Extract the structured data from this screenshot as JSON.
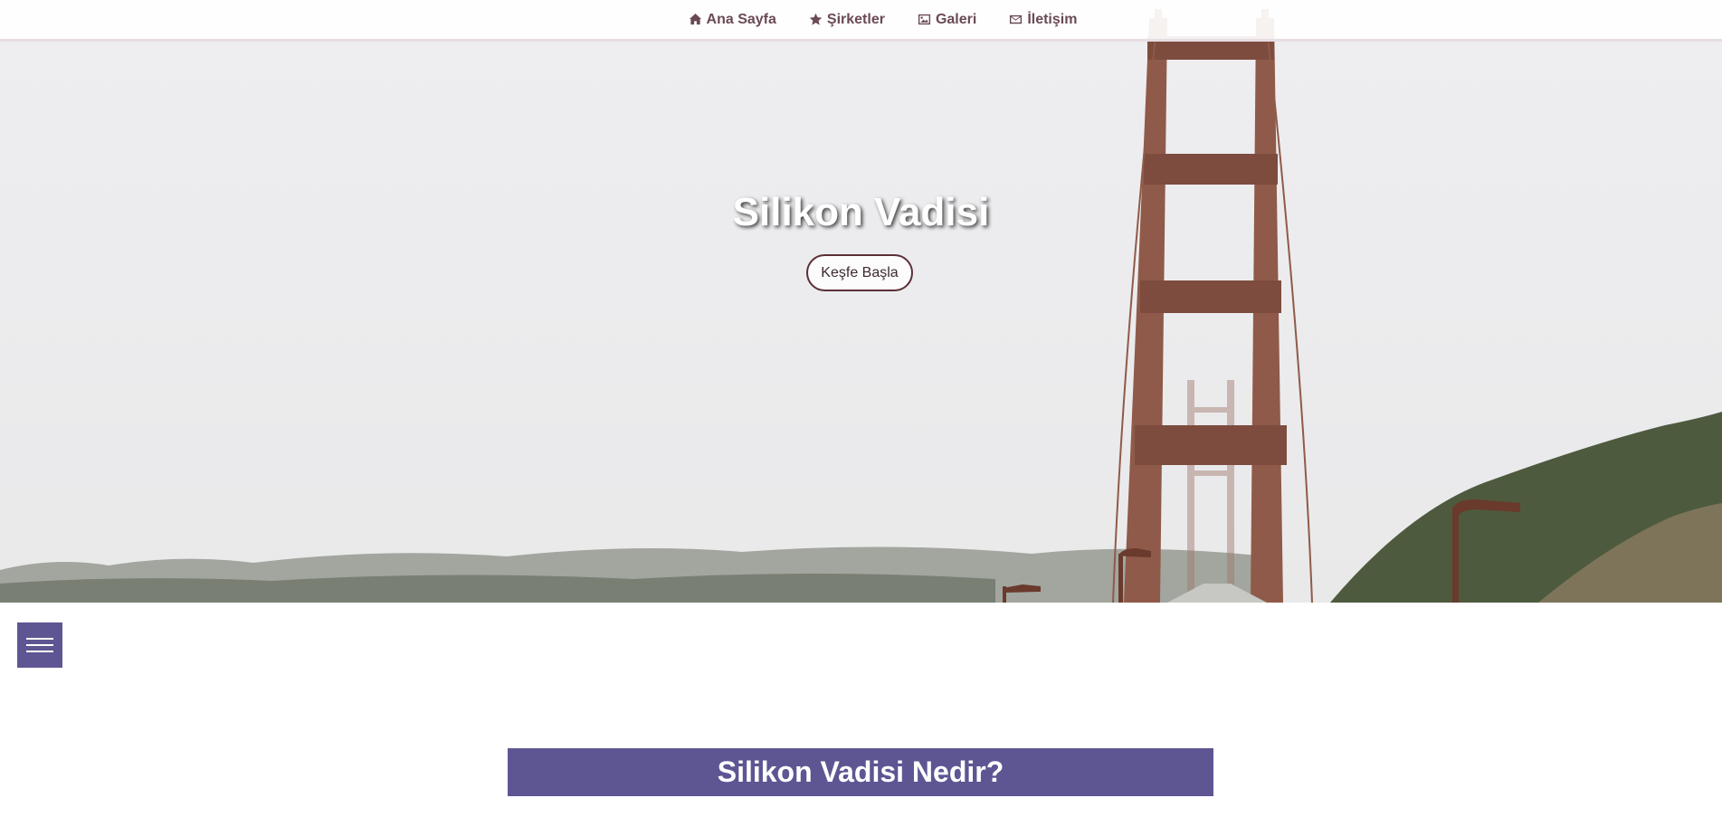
{
  "nav": {
    "items": [
      {
        "label": "Ana Sayfa",
        "icon": "home-icon"
      },
      {
        "label": "Şirketler",
        "icon": "star-icon"
      },
      {
        "label": "Galeri",
        "icon": "image-icon"
      },
      {
        "label": "İletişim",
        "icon": "envelope-icon"
      }
    ]
  },
  "hero": {
    "title": "Silikon Vadisi",
    "cta_label": "Keşfe Başla"
  },
  "menu": {
    "icon": "hamburger-icon"
  },
  "section": {
    "heading": "Silikon Vadisi Nedir?"
  },
  "colors": {
    "accent": "#5d5693",
    "nav_text": "#6a4a54",
    "bridge": "#8f5a49"
  }
}
